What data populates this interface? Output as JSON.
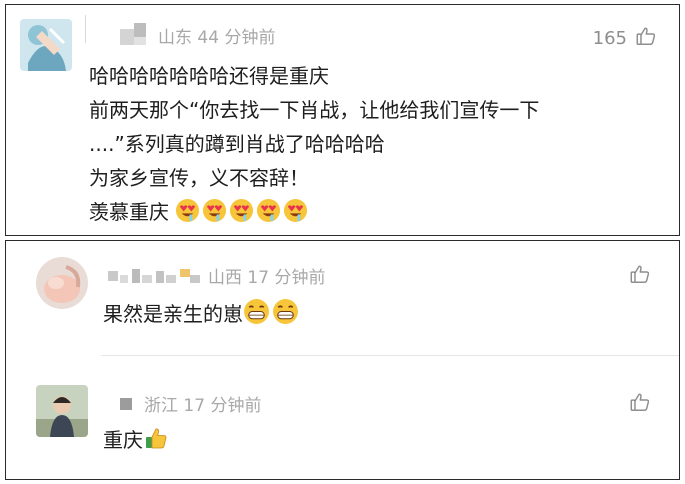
{
  "comment1": {
    "location_time": "山东 44 分钟前",
    "like_count": "165",
    "lines": [
      "哈哈哈哈哈哈哈还得是重庆",
      "前两天那个“你去找一下肖战，让他给我们宣传一下",
      "....”系列真的蹲到肖战了哈哈哈哈",
      "为家乡宣传，义不容辞！",
      "羡慕重庆"
    ],
    "emojis": [
      "heart-eyes-emoji",
      "heart-eyes-emoji",
      "heart-eyes-emoji",
      "heart-eyes-emoji",
      "heart-eyes-emoji"
    ]
  },
  "reply1": {
    "location_time": "山西 17 分钟前",
    "text": "果然是亲生的崽",
    "emojis": [
      "grin-emoji",
      "grin-emoji"
    ]
  },
  "reply2": {
    "location_time": "浙江 17 分钟前",
    "text": "重庆",
    "emojis": [
      "thumbs-up-emoji"
    ]
  },
  "colors": {
    "meta_gray": "#a8a8a8",
    "text": "#1e1e1e",
    "border": "#2b2b2b"
  }
}
